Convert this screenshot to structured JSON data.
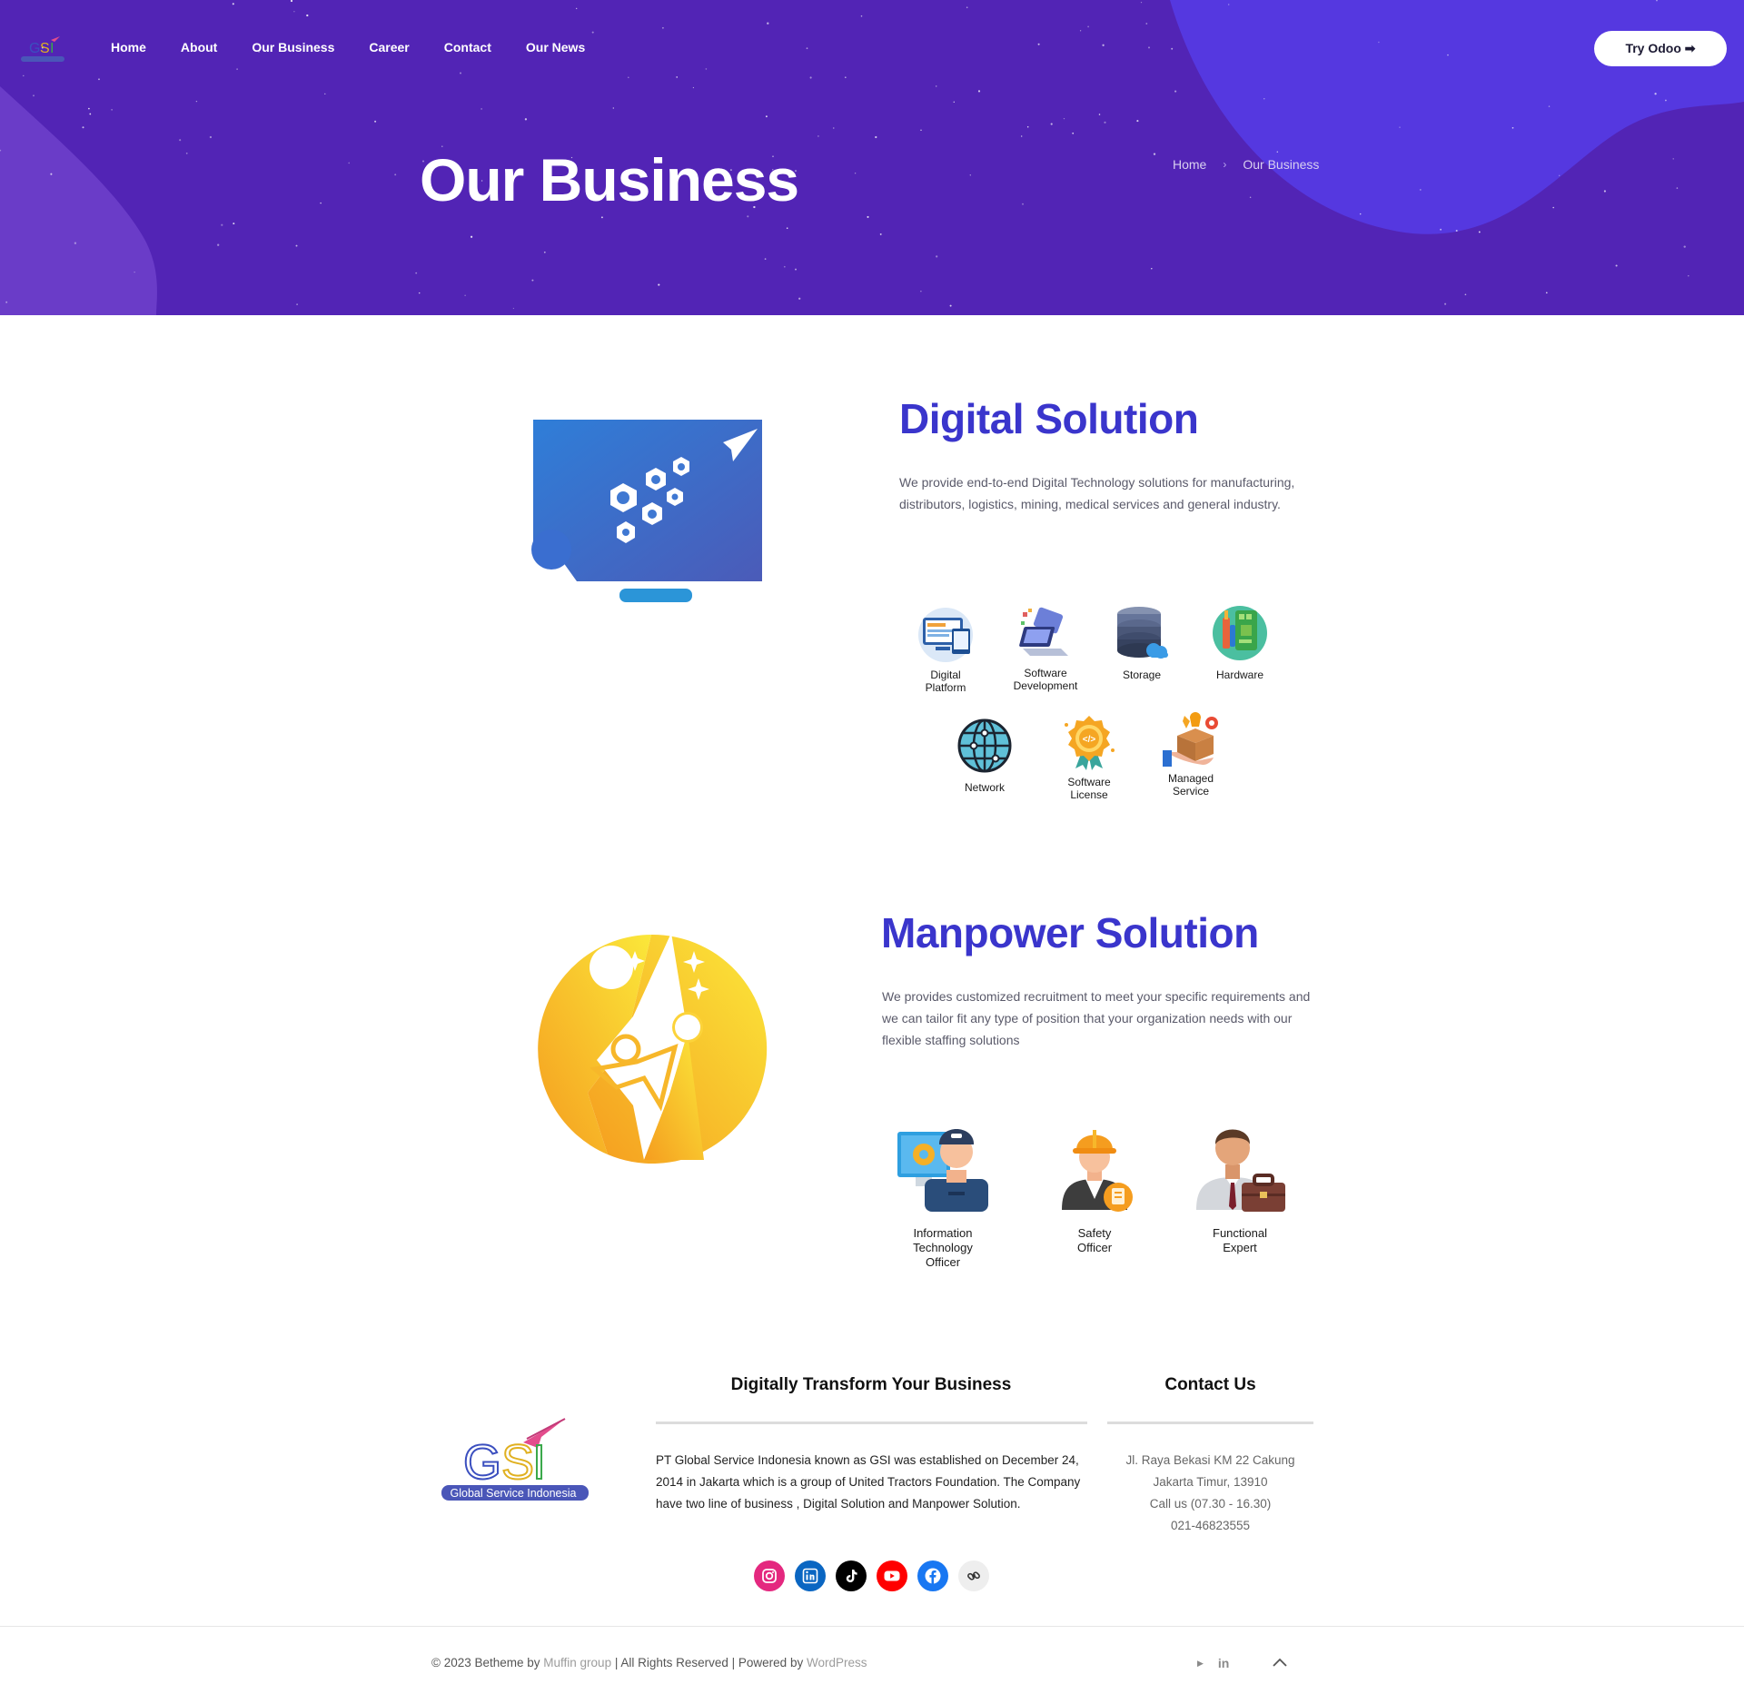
{
  "nav": {
    "logo_alt": "GSI Global Service Indonesia",
    "items": [
      "Home",
      "About",
      "Our Business",
      "Career",
      "Contact",
      "Our News"
    ],
    "cta_label": "Try Odoo ➡"
  },
  "hero": {
    "title": "Our Business",
    "breadcrumb": {
      "home": "Home",
      "separator": "›",
      "current": "Our Business"
    }
  },
  "digital": {
    "title": "Digital Solution",
    "description": "We provide end-to-end Digital Technology solutions for manufacturing, distributors, logistics, mining, medical services and general industry.",
    "services": [
      {
        "icon": "digital-platform-icon",
        "label": "Digital\nPlatform"
      },
      {
        "icon": "software-development-icon",
        "label": "Software\nDevelopment"
      },
      {
        "icon": "storage-icon",
        "label": "Storage"
      },
      {
        "icon": "hardware-icon",
        "label": "Hardware"
      },
      {
        "icon": "network-icon",
        "label": "Network"
      },
      {
        "icon": "software-license-icon",
        "label": "Software\nLicense"
      },
      {
        "icon": "managed-service-icon",
        "label": "Managed\nService"
      }
    ]
  },
  "manpower": {
    "title": "Manpower Solution",
    "description": "We provides customized recruitment to meet your specific requirements and we can tailor fit any type of position that your organization needs with our flexible staffing solutions",
    "roles": [
      {
        "icon": "it-officer-icon",
        "label": "Information\nTechnology\nOfficer"
      },
      {
        "icon": "safety-officer-icon",
        "label": "Safety\nOfficer"
      },
      {
        "icon": "functional-expert-icon",
        "label": "Functional\nExpert"
      }
    ]
  },
  "footer": {
    "logo_caption": "Global Service Indonesia",
    "about_heading": "Digitally Transform Your Business",
    "about_text": "PT Global Service Indonesia known as GSI was established on December 24, 2014  in Jakarta which is a group of United Tractors Foundation. The Company  have two line of business , Digital Solution and Manpower Solution.",
    "contact_heading": "Contact Us",
    "contact_lines": [
      "Jl. Raya Bekasi KM 22 Cakung",
      "Jakarta Timur, 13910",
      "Call us (07.30 - 16.30)",
      "021-46823555"
    ],
    "socials": [
      {
        "icon": "instagram-icon",
        "color": "#e4287f"
      },
      {
        "icon": "linkedin-icon",
        "color": "#0a66c2"
      },
      {
        "icon": "tiktok-icon",
        "color": "#000000"
      },
      {
        "icon": "youtube-icon",
        "color": "#ff0000"
      },
      {
        "icon": "facebook-icon",
        "color": "#1877f2"
      },
      {
        "icon": "link-icon",
        "color": "#eeeeee"
      }
    ],
    "copyright_prefix": "© 2023 Betheme by ",
    "copyright_link1": "Muffin group",
    "copyright_middle": " | All Rights Reserved | Powered by ",
    "copyright_link2": "WordPress",
    "bottom_icon_play": "▶",
    "bottom_icon_linkedin": "in"
  },
  "colors": {
    "hero_bg": "#5224b5",
    "hero_blob": "#5538e0",
    "accent_title": "#3a35cc"
  }
}
